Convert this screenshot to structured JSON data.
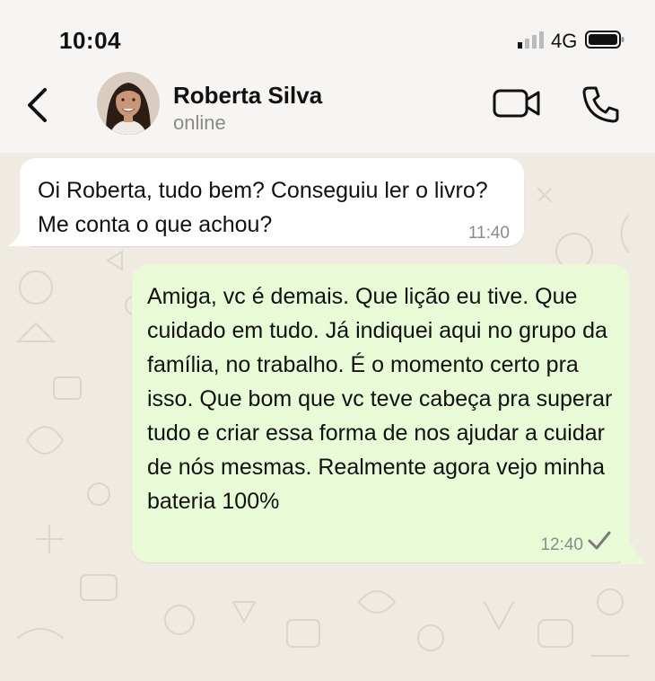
{
  "status_bar": {
    "time": "10:04",
    "network": "4G",
    "signal_icon": "signal-bars-icon",
    "battery_icon": "battery-icon"
  },
  "header": {
    "contact_name": "Roberta Silva",
    "presence": "online",
    "icons": [
      "back-chevron-icon",
      "video-call-icon",
      "phone-icon"
    ]
  },
  "messages": [
    {
      "direction": "incoming",
      "text": "Oi Roberta, tudo bem? Conseguiu ler o livro? Me conta o que achou?",
      "time": "11:40"
    },
    {
      "direction": "outgoing",
      "text": "Amiga, vc é demais. Que lição eu tive. Que cuidado em tudo. Já indiquei aqui no grupo da família, no trabalho. É o momento certo pra isso. Que bom que vc teve cabeça pra superar tudo e criar essa forma de nos ajudar a cuidar de nós mesmas. Realmente agora vejo minha bateria 100%",
      "time": "12:40",
      "status_icon": "sent-check-icon"
    }
  ],
  "colors": {
    "chat_background": "#efeae2",
    "incoming_bubble": "#ffffff",
    "outgoing_bubble": "#e8fbd6",
    "header_background": "#f6f5f3",
    "secondary_text": "#8b8b8b"
  }
}
